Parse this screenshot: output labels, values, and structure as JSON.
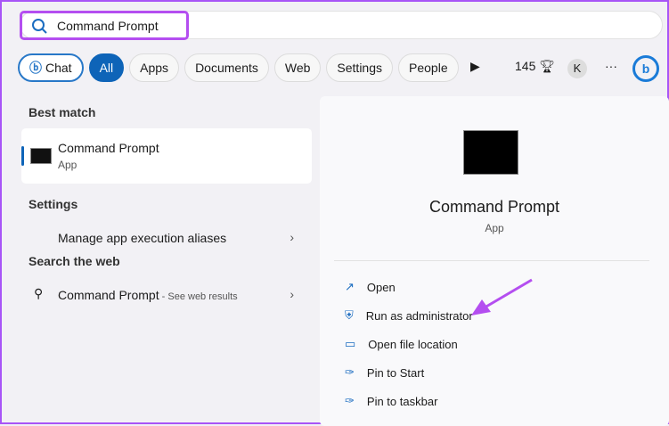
{
  "search": {
    "value": "Command Prompt"
  },
  "filters": {
    "chat": "Chat",
    "items": [
      "All",
      "Apps",
      "Documents",
      "Web",
      "Settings",
      "People"
    ],
    "points": "145",
    "avatar": "K",
    "more": "···"
  },
  "left": {
    "best_match_heading": "Best match",
    "best": {
      "title": "Command Prompt",
      "subtitle": "App"
    },
    "settings_heading": "Settings",
    "settings_item": "Manage app execution aliases",
    "web_heading": "Search the web",
    "web_item": "Command Prompt",
    "web_suffix": " - See web results"
  },
  "right": {
    "title": "Command Prompt",
    "subtitle": "App",
    "actions": [
      "Open",
      "Run as administrator",
      "Open file location",
      "Pin to Start",
      "Pin to taskbar"
    ]
  },
  "colors": {
    "accent": "#0e64b8",
    "highlight": "#b44ef0"
  }
}
